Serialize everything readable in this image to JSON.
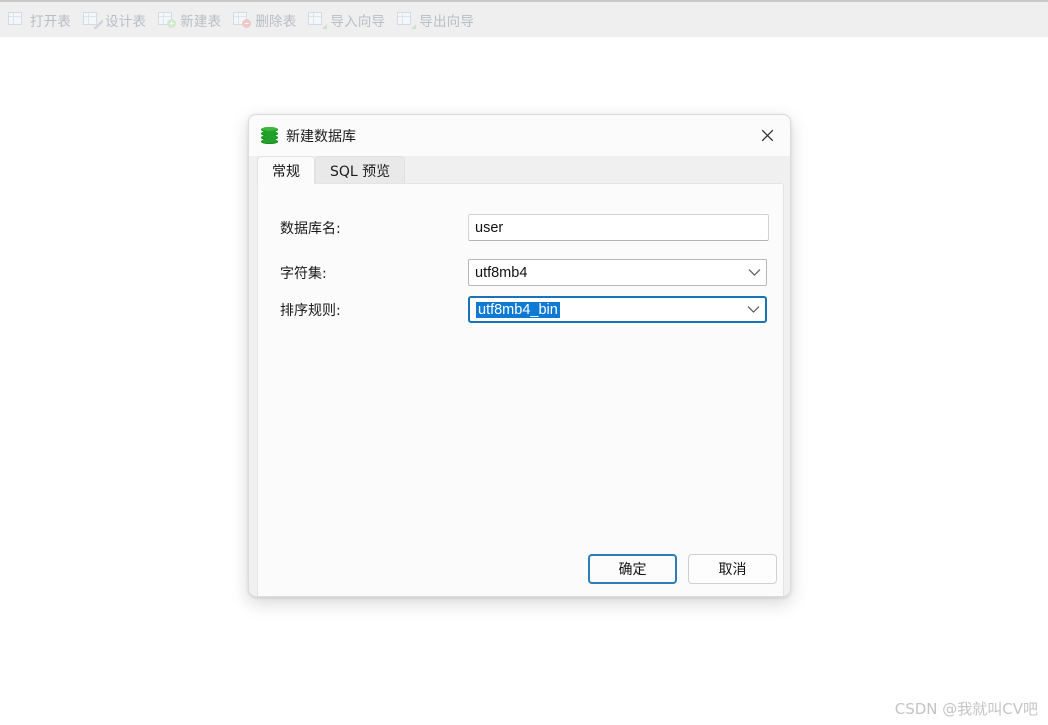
{
  "app": {
    "toolbar": {
      "items": [
        {
          "label": "打开表",
          "icon": "open-table-icon"
        },
        {
          "label": "设计表",
          "icon": "design-table-icon"
        },
        {
          "label": "新建表",
          "icon": "new-table-icon"
        },
        {
          "label": "删除表",
          "icon": "delete-table-icon"
        },
        {
          "label": "导入向导",
          "icon": "import-wizard-icon"
        },
        {
          "label": "导出向导",
          "icon": "export-wizard-icon"
        }
      ]
    }
  },
  "dialog": {
    "title": "新建数据库",
    "icon": "database-icon",
    "close_icon": "close-icon",
    "tabs": [
      {
        "label": "常规",
        "active": true
      },
      {
        "label": "SQL 预览",
        "active": false
      }
    ],
    "fields": [
      {
        "label": "数据库名:",
        "type": "text",
        "value": "user",
        "placeholder": ""
      },
      {
        "label": "字符集:",
        "type": "select",
        "value": "utf8mb4",
        "focused": false,
        "selected_text": false
      },
      {
        "label": "排序规则:",
        "type": "select",
        "value": "utf8mb4_bin",
        "focused": true,
        "selected_text": true
      }
    ],
    "buttons": {
      "confirm": "确定",
      "cancel": "取消"
    }
  },
  "watermark": "CSDN @我就叫CV吧",
  "colors": {
    "accent_blue": "#0f7ad4",
    "focus_border": "#1b72b8",
    "primary_button_border": "#2d7cb8",
    "toolbar_bg": "#efefef",
    "dialog_bg": "#f0f0f0",
    "panel_bg": "#fbfbfb",
    "db_icon_green": "#22a22a",
    "disabled_text": "#b8bec5",
    "watermark_text": "#c4c4c4"
  }
}
